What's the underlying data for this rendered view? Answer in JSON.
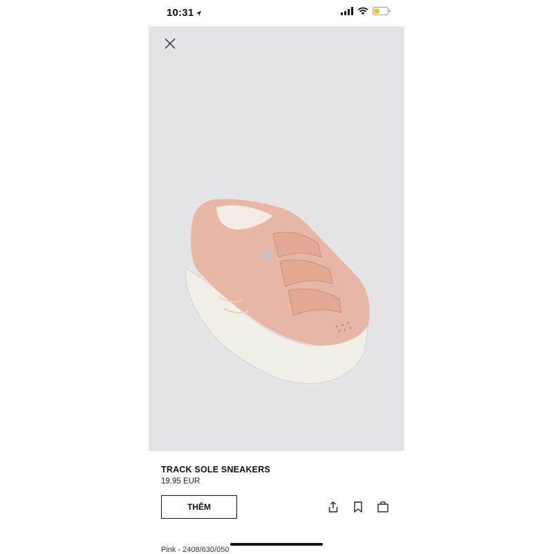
{
  "status_bar": {
    "time": "10:31"
  },
  "product": {
    "title": "TRACK SOLE SNEAKERS",
    "price": "19.95 EUR",
    "add_label": "THÊM",
    "color_ref": "Pink - 2408/630/050"
  },
  "icons": {
    "close": "close-icon",
    "share": "share-icon",
    "bookmark": "bookmark-icon",
    "bag": "shopping-bag-icon"
  },
  "colors": {
    "photo_background": "#e5e5e7",
    "shoe": "#e8b6a4",
    "sole": "#f2efe9"
  }
}
